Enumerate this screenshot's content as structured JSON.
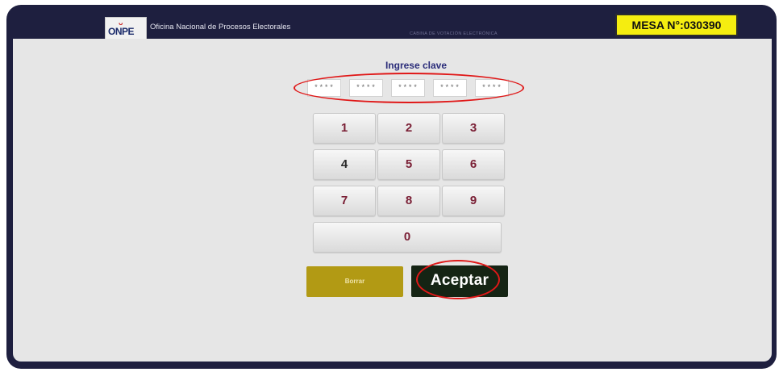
{
  "header": {
    "logo_mark": "ᴗ",
    "logo_text": "ONPE",
    "org_name": "Oficina Nacional de Procesos Electorales",
    "subtitle": "CABINA DE VOTACIÓN ELECTRÓNICA",
    "mesa_label": "MESA N°:030390"
  },
  "login": {
    "prompt": "Ingrese clave",
    "fields": [
      {
        "value": "****"
      },
      {
        "value": "****"
      },
      {
        "value": "****"
      },
      {
        "value": "****"
      },
      {
        "value": "****"
      }
    ]
  },
  "keypad": {
    "keys": [
      "1",
      "2",
      "3",
      "4",
      "5",
      "6",
      "7",
      "8",
      "9",
      "0"
    ]
  },
  "actions": {
    "clear_label": "Borrar",
    "accept_label": "Aceptar"
  },
  "colors": {
    "frame": "#1e1f3f",
    "mesa_badge": "#f5ed10",
    "clear_button": "#b29a14",
    "accept_button": "#152414",
    "highlight": "#e01818"
  }
}
